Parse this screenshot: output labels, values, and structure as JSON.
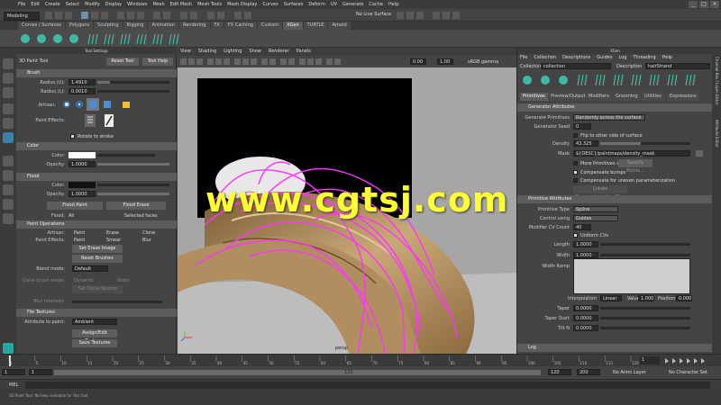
{
  "menubar": {
    "items": [
      "File",
      "Edit",
      "Create",
      "Select",
      "Modify",
      "Display",
      "Windows",
      "Mesh",
      "Edit Mesh",
      "Mesh Tools",
      "Mesh Display",
      "Curves",
      "Surfaces",
      "Deform",
      "UV",
      "Generate",
      "Cache",
      "Help"
    ]
  },
  "statusline": {
    "mode": "Modeling",
    "live_surface": "No Live Surface"
  },
  "shelf": {
    "tabs": [
      "Curves / Surfaces",
      "Polygons",
      "Sculpting",
      "Rigging",
      "Animation",
      "Rendering",
      "FX",
      "FX Caching",
      "Custom",
      "XGen",
      "TURTLE",
      "Arnold"
    ],
    "active_tab": "XGen"
  },
  "tool_settings": {
    "panel_title": "Tool Settings",
    "tool_name": "3D Paint Tool",
    "reset_label": "Reset Tool",
    "help_label": "Tool Help",
    "brush": {
      "header": "Brush",
      "radius_u_label": "Radius (U):",
      "radius_u": "1.4910",
      "radius_l_label": "Radius (L):",
      "radius_l": "0.0010",
      "artisan_label": "Artisan:",
      "paint_effects_label": "Paint Effects:",
      "rotate_label": "Rotate to stroke"
    },
    "color": {
      "header": "Color",
      "color_label": "Color:",
      "opacity_label": "Opacity:",
      "opacity": "1.0000"
    },
    "flood": {
      "header": "Flood",
      "color_label": "Color:",
      "opacity_label": "Opacity:",
      "opacity": "1.0000",
      "flood_paint": "Flood Paint",
      "flood_erase": "Flood Erase",
      "flood_label": "Flood:",
      "flood_all": "All",
      "flood_selected": "Selected faces"
    },
    "paint_operations": {
      "header": "Paint Operations",
      "artisan_label": "Artisan:",
      "artisan_options": [
        "Paint",
        "Erase",
        "Clone"
      ],
      "pe_label": "Paint Effects:",
      "pe_options": [
        "Paint",
        "Smear",
        "Blur"
      ],
      "set_erase_image": "Set Erase Image",
      "reset_brushes": "Reset Brushes",
      "blend_mode_label": "Blend mode:",
      "blend_mode": "Default",
      "clone_brush_label": "Clone brush mode:",
      "clone_dynamic": "Dynamic",
      "clone_static": "Static",
      "set_clone_source": "Set Clone Source",
      "blur_intensity_label": "Blur intensity:"
    },
    "file_textures": {
      "header": "File Textures",
      "attribute_label": "Attribute to paint:",
      "attribute": "Ambient",
      "assign_edit": "Assign/Edit Textures",
      "save_textures": "Save Textures"
    }
  },
  "viewport": {
    "menu": [
      "View",
      "Shading",
      "Lighting",
      "Show",
      "Renderer",
      "Panels"
    ],
    "gamma": "sRGB gamma",
    "camera": "persp",
    "field_a": "0.00",
    "field_b": "1.00"
  },
  "watermark": "www.cgtsj.com",
  "xgen": {
    "title": "XGen",
    "menu": [
      "File",
      "Collection",
      "Descriptions",
      "Guides",
      "Log",
      "Threading",
      "Help"
    ],
    "collection_label": "Collection",
    "collection_value": "collection",
    "description_label": "Description",
    "description_value": "hairStrand",
    "tabs": [
      "Primitives",
      "Preview/Output",
      "Modifiers",
      "Grooming",
      "Utilities",
      "Expressions"
    ],
    "active_tab": "Primitives",
    "generator_header": "Generator Attributes",
    "generate_primitives_label": "Generate Primitives",
    "generate_primitives": "Randomly across the surface",
    "generator_seed_label": "Generator Seed",
    "generator_seed": "0",
    "flip_label": "Flip to other side of surface",
    "density_label": "Density",
    "density": "43.325",
    "mask_label": "Mask",
    "mask_value": "${DESC}/paintmaps/density_mask",
    "more_primitives_label": "More Primitives at",
    "specify_points": "Specify Points...",
    "compensate_bumps": "Compensate bumps",
    "compensate_uneven": "Compensate for uneven parameterization",
    "create_param_map": "Create Parameterization Map",
    "primitive_header": "Primitive Attributes",
    "primitive_type_label": "Primitive Type",
    "primitive_type": "Spline",
    "control_using_label": "Control using",
    "control_using": "Guides",
    "modifier_cv_label": "Modifier CV Count",
    "modifier_cv": "40",
    "uniform_cvs": "Uniform CVs",
    "length_label": "Length",
    "length": "1.0000",
    "width_label": "Width",
    "width": "1.0000",
    "width_ramp_label": "Width Ramp",
    "ramp_left": "",
    "interpolation_label": "Interpolation",
    "interpolation": "Linear",
    "value_label": "Value",
    "value": "1.000",
    "position_label": "Position",
    "position": "0.000",
    "taper_label": "Taper",
    "taper": "0.0000",
    "taper_start_label": "Taper Start",
    "taper_start": "0.0000",
    "tilt_label": "Tilt N",
    "tilt": "0.0000",
    "log_label": "Log"
  },
  "timeline": {
    "ticks": [
      "1",
      "5",
      "10",
      "15",
      "20",
      "25",
      "30",
      "35",
      "40",
      "45",
      "50",
      "55",
      "60",
      "65",
      "70",
      "75",
      "80",
      "85",
      "90",
      "95",
      "100",
      "105",
      "110",
      "115",
      "120"
    ],
    "current_frame": "1"
  },
  "range": {
    "start": "1",
    "range_start": "1",
    "range_value": "120",
    "range_end": "120",
    "end": "200",
    "anim_layer": "No Anim Layer",
    "char_set": "No Character Set"
  },
  "command": {
    "label": "MEL"
  },
  "help_line": {
    "text": "3D Paint Tool: No help available for this tool"
  },
  "right_strip": {
    "labels": [
      "Channel Box / Layer Editor",
      "Attribute Editor"
    ]
  },
  "colors": {
    "accent": "#5285a6",
    "guides": "#ff33ff",
    "watermark": "#ffff33"
  }
}
